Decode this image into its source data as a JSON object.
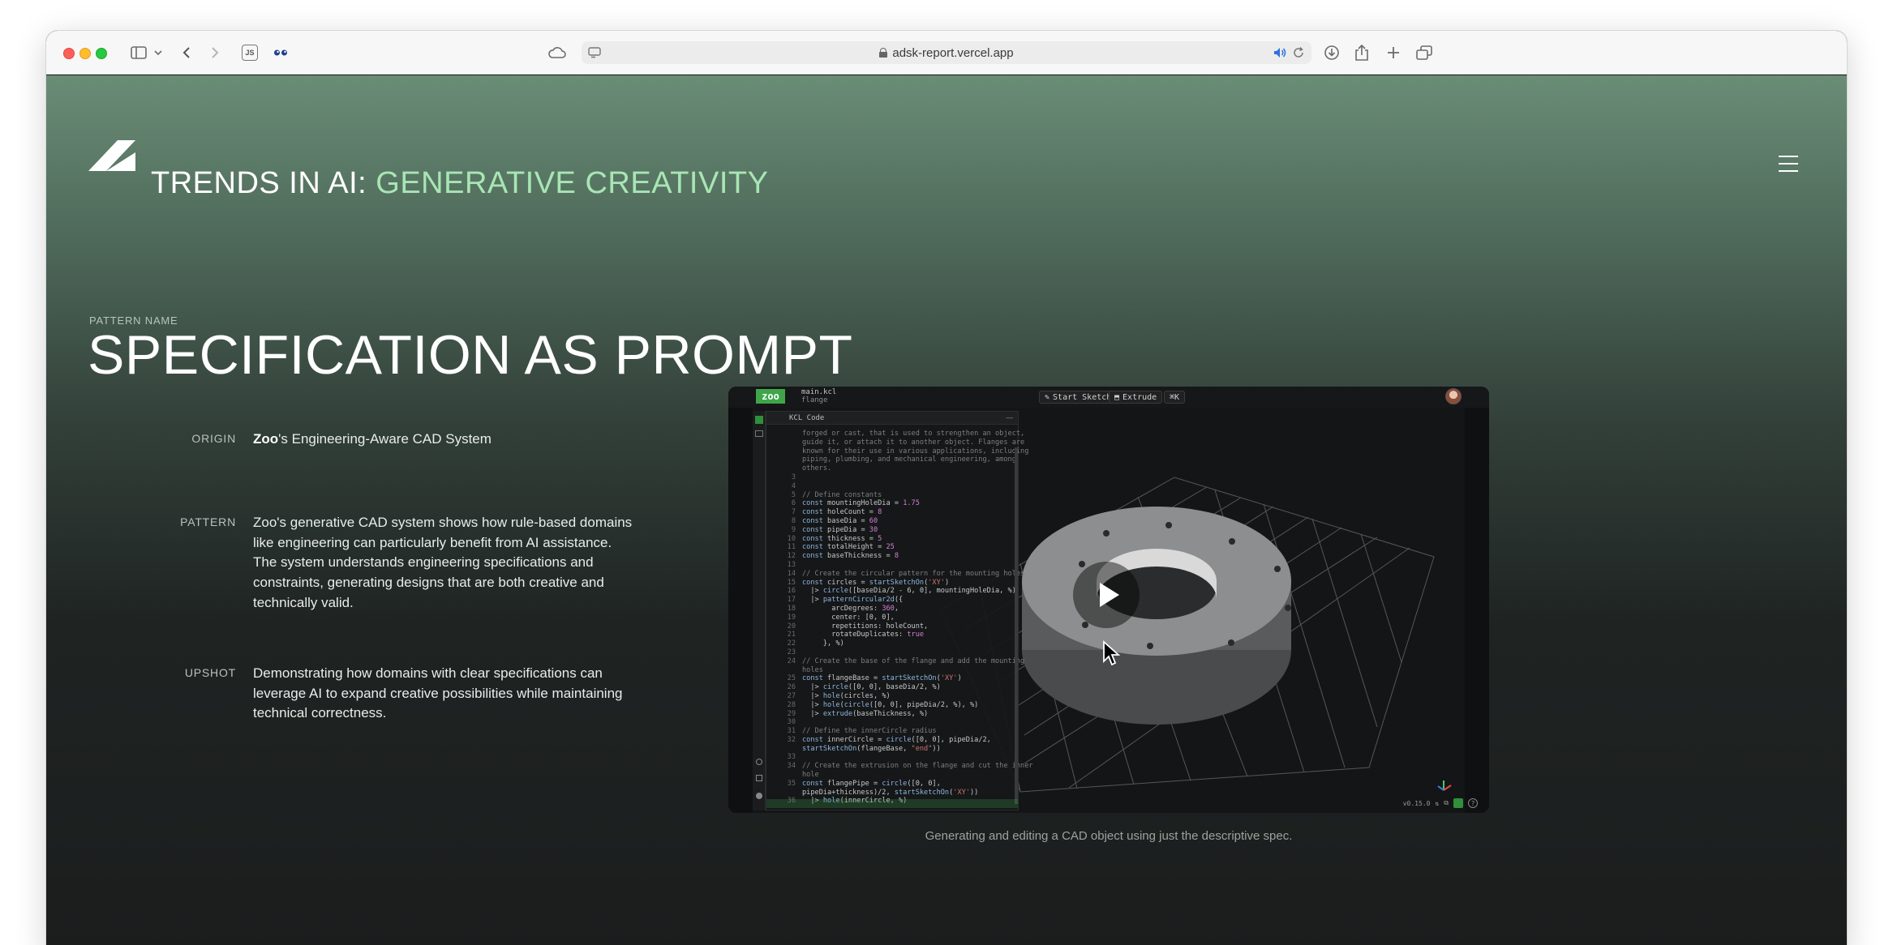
{
  "browser": {
    "url": "adsk-report.vercel.app",
    "extension_badge": "JS"
  },
  "site": {
    "title_prefix": "TRENDS IN AI:",
    "title_accent": "GENERATIVE CREATIVITY",
    "accent_color": "#a8e6b4"
  },
  "pattern": {
    "label": "PATTERN NAME",
    "name": "SPECIFICATION AS PROMPT"
  },
  "details": {
    "origin_label": "ORIGIN",
    "origin_strong": "Zoo",
    "origin_rest": "'s Engineering-Aware CAD System",
    "pattern_label": "PATTERN",
    "pattern_text": "Zoo's generative CAD system shows how rule-based domains like engineering can particularly benefit from AI assistance. The system understands engineering specifications and constraints, generating designs that are both creative and technically valid.",
    "upshot_label": "UPSHOT",
    "upshot_text": "Demonstrating how domains with clear specifications can leverage AI to expand creative possibilities while maintaining technical correctness."
  },
  "video": {
    "app_badge": "zoo",
    "file_name": "main.kcl",
    "file_sub": "flange",
    "btn_start_sketch": "Start Sketch",
    "btn_extrude": "Extrude",
    "btn_shortcut": "⌘K",
    "panel_title": "KCL Code",
    "version": "v0.15.0",
    "caption": "Generating and editing a CAD object using just the descriptive spec."
  }
}
